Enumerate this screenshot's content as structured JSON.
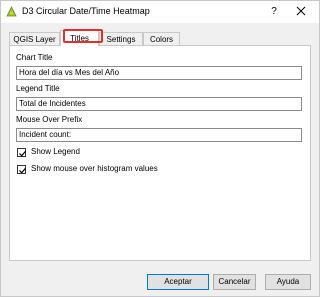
{
  "window": {
    "title": "D3 Circular Date/Time Heatmap",
    "help_label": "?"
  },
  "tabs": [
    {
      "label": "QGIS Layer",
      "active": false
    },
    {
      "label": "Titles",
      "active": true
    },
    {
      "label": "Settings",
      "active": false
    },
    {
      "label": "Colors",
      "active": false
    }
  ],
  "fields": {
    "chart_title": {
      "label": "Chart Title",
      "value": "Hora del día vs Mes del Año"
    },
    "legend_title": {
      "label": "Legend Title",
      "value": "Total de Incidentes"
    },
    "mouse_over_prefix": {
      "label": "Mouse Over Prefix",
      "value": "Incident count:"
    }
  },
  "checkboxes": {
    "show_legend": {
      "label": "Show Legend",
      "checked": true
    },
    "show_histogram": {
      "label": "Show mouse over histogram values",
      "checked": true
    }
  },
  "buttons": {
    "accept": "Aceptar",
    "cancel": "Cancelar",
    "help": "Ayuda"
  },
  "colors": {
    "highlight": "#e62e2e",
    "default_button_border": "#0078d7"
  }
}
